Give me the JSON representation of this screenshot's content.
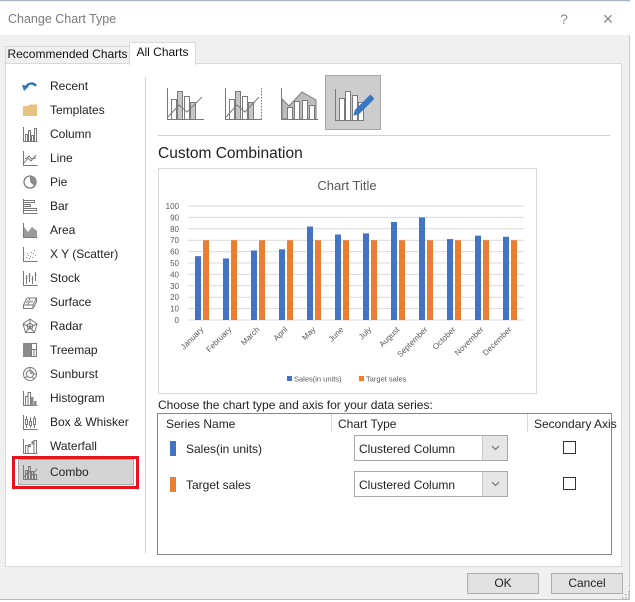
{
  "window": {
    "title": "Change Chart Type",
    "help_label": "?",
    "close_label": "×"
  },
  "tabs": [
    {
      "label": "Recommended Charts",
      "active": false
    },
    {
      "label": "All Charts",
      "active": true
    }
  ],
  "sidebar": {
    "selected": "Combo",
    "items": [
      {
        "label": "Recent",
        "icon": "recent-icon"
      },
      {
        "label": "Templates",
        "icon": "folder-icon"
      },
      {
        "label": "Column",
        "icon": "column-chart-icon"
      },
      {
        "label": "Line",
        "icon": "line-chart-icon"
      },
      {
        "label": "Pie",
        "icon": "pie-chart-icon"
      },
      {
        "label": "Bar",
        "icon": "bar-chart-icon"
      },
      {
        "label": "Area",
        "icon": "area-chart-icon"
      },
      {
        "label": "X Y (Scatter)",
        "icon": "scatter-chart-icon"
      },
      {
        "label": "Stock",
        "icon": "stock-chart-icon"
      },
      {
        "label": "Surface",
        "icon": "surface-chart-icon"
      },
      {
        "label": "Radar",
        "icon": "radar-chart-icon"
      },
      {
        "label": "Treemap",
        "icon": "treemap-chart-icon"
      },
      {
        "label": "Sunburst",
        "icon": "sunburst-chart-icon"
      },
      {
        "label": "Histogram",
        "icon": "histogram-chart-icon"
      },
      {
        "label": "Box & Whisker",
        "icon": "box-whisker-chart-icon"
      },
      {
        "label": "Waterfall",
        "icon": "waterfall-chart-icon"
      },
      {
        "label": "Combo",
        "icon": "combo-chart-icon"
      }
    ]
  },
  "subtypes": [
    {
      "icon": "column-line-icon",
      "selected": false
    },
    {
      "icon": "column-line-secondary-axis-icon",
      "selected": false
    },
    {
      "icon": "area-column-icon",
      "selected": false
    },
    {
      "icon": "custom-combination-icon",
      "selected": true
    }
  ],
  "section_title": "Custom Combination",
  "chart_data": {
    "type": "bar",
    "title": "Chart Title",
    "xlabel": "",
    "ylabel": "",
    "categories": [
      "January",
      "February",
      "March",
      "April",
      "May",
      "June",
      "July",
      "August",
      "September",
      "October",
      "November",
      "December"
    ],
    "series": [
      {
        "name": "Sales(in units)",
        "color": "#4472c4",
        "values": [
          56,
          54,
          61,
          62,
          82,
          75,
          76,
          86,
          90,
          71,
          74,
          73
        ]
      },
      {
        "name": "Target sales",
        "color": "#ed7d31",
        "values": [
          70,
          70,
          70,
          70,
          70,
          70,
          70,
          70,
          70,
          70,
          70,
          70
        ]
      }
    ],
    "ylim": [
      0,
      100
    ],
    "yticks": [
      0,
      10,
      20,
      30,
      40,
      50,
      60,
      70,
      80,
      90,
      100
    ],
    "grid": true,
    "legend": "bottom"
  },
  "series_config": {
    "prompt": "Choose the chart type and axis for your data series:",
    "headers": {
      "series_name": "Series Name",
      "chart_type": "Chart Type",
      "secondary_axis": "Secondary Axis"
    },
    "rows": [
      {
        "name": "Sales(in units)",
        "color": "#4472c4",
        "chart_type": "Clustered Column",
        "secondary_axis": false
      },
      {
        "name": "Target sales",
        "color": "#ed7d31",
        "chart_type": "Clustered Column",
        "secondary_axis": false
      }
    ]
  },
  "buttons": {
    "ok": "OK",
    "cancel": "Cancel"
  },
  "colors": {
    "highlight": "#e8141c",
    "series1": "#4472c4",
    "series2": "#ed7d31",
    "accent_icon": "#2e75b6"
  }
}
